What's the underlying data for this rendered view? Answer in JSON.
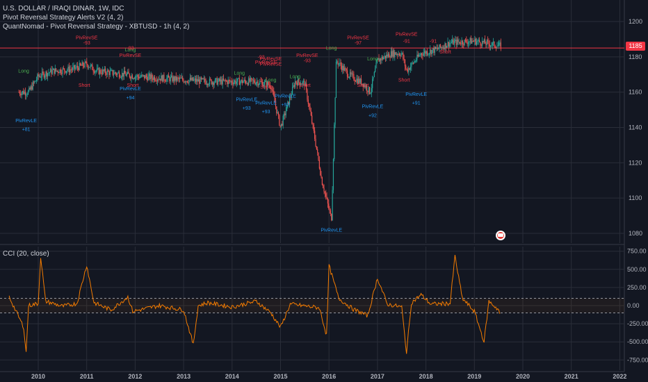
{
  "header": {
    "symbol_line": "U.S. DOLLAR / IRAQI DINAR, 1W, IDC",
    "indicator_1": "Pivot Reversal Strategy Alerts V2 (4, 2)",
    "indicator_2": "QuantNomad - Pivot Reversal Strategy - XBTUSD - 1h (4, 2)",
    "cci_label": "CCI (20, close)"
  },
  "price_badge": {
    "value": "1185",
    "color": "#f23645"
  },
  "colors": {
    "up": "#26a69a",
    "down": "#ef5350",
    "cci": "#f57c00",
    "grid": "#2a2e39",
    "bg": "#131722",
    "long": "#4caf50",
    "short": "#f23645",
    "pivot_le": "#2196f3",
    "pivot_se": "#f23645"
  },
  "chart_data": [
    {
      "type": "candlestick",
      "title": "U.S. DOLLAR / IRAQI DINAR, 1W, IDC",
      "x_tick_labels": [
        "2010",
        "2011",
        "2012",
        "2013",
        "2014",
        "2015",
        "2016",
        "2017",
        "2018",
        "2019",
        "2020",
        "2021",
        "2022"
      ],
      "y_tick_labels": [
        "1200",
        "1180",
        "1160",
        "1140",
        "1120",
        "1100",
        "1080"
      ],
      "ylim": [
        1075,
        1205
      ],
      "last_price": 1185,
      "grid": true,
      "approx_close_path": [
        {
          "x": 2009.6,
          "y": 1160
        },
        {
          "x": 2009.8,
          "y": 1160
        },
        {
          "x": 2010.0,
          "y": 1169
        },
        {
          "x": 2010.3,
          "y": 1172
        },
        {
          "x": 2010.7,
          "y": 1173
        },
        {
          "x": 2011.0,
          "y": 1176
        },
        {
          "x": 2011.2,
          "y": 1172
        },
        {
          "x": 2011.5,
          "y": 1171
        },
        {
          "x": 2011.8,
          "y": 1170
        },
        {
          "x": 2012.0,
          "y": 1169
        },
        {
          "x": 2012.5,
          "y": 1168
        },
        {
          "x": 2013.0,
          "y": 1167
        },
        {
          "x": 2013.5,
          "y": 1166
        },
        {
          "x": 2014.0,
          "y": 1166
        },
        {
          "x": 2014.5,
          "y": 1166
        },
        {
          "x": 2014.8,
          "y": 1164
        },
        {
          "x": 2015.0,
          "y": 1140
        },
        {
          "x": 2015.3,
          "y": 1166
        },
        {
          "x": 2015.5,
          "y": 1165
        },
        {
          "x": 2015.7,
          "y": 1135
        },
        {
          "x": 2015.85,
          "y": 1110
        },
        {
          "x": 2016.05,
          "y": 1088
        },
        {
          "x": 2016.15,
          "y": 1178
        },
        {
          "x": 2016.4,
          "y": 1170
        },
        {
          "x": 2016.7,
          "y": 1165
        },
        {
          "x": 2016.85,
          "y": 1160
        },
        {
          "x": 2017.0,
          "y": 1178
        },
        {
          "x": 2017.3,
          "y": 1182
        },
        {
          "x": 2017.5,
          "y": 1182
        },
        {
          "x": 2017.6,
          "y": 1172
        },
        {
          "x": 2017.9,
          "y": 1182
        },
        {
          "x": 2018.2,
          "y": 1184
        },
        {
          "x": 2018.5,
          "y": 1188
        },
        {
          "x": 2019.0,
          "y": 1189
        },
        {
          "x": 2019.55,
          "y": 1186
        }
      ],
      "annotations": {
        "long": [
          "Long",
          "Long",
          "Long",
          "Long",
          "Long",
          "Long",
          "Long"
        ],
        "short": [
          "Short",
          "Short",
          "Short",
          "Short",
          "Short",
          "Short",
          "Short"
        ],
        "pivot_le": [
          "PivRevLE",
          "+81",
          "PivRevLE",
          "+94",
          "PivRevLE",
          "+93",
          "PivRevLE",
          "+93",
          "PivRevLE",
          "+92",
          "PivRevLE",
          "PivRevLE",
          "+92",
          "PivRevLE",
          "+91"
        ],
        "pivot_se": [
          "PivRevSE",
          "-93",
          "PivRevSE",
          "-93",
          "PivRevSE",
          "-93",
          "PivRevSE",
          "PivRevSE",
          "-93",
          "PivRevSE",
          "-97",
          "PivRevSE",
          "-91",
          "PivRevSE",
          "-91"
        ]
      }
    },
    {
      "type": "line",
      "title": "CCI (20, close)",
      "x_tick_labels": [
        "2010",
        "2011",
        "2012",
        "2013",
        "2014",
        "2015",
        "2016",
        "2017",
        "2018",
        "2019",
        "2020",
        "2021",
        "2022"
      ],
      "y_tick_labels": [
        "750.00",
        "500.00",
        "250.00",
        "0.00",
        "-250.00",
        "-500.00",
        "-750.00"
      ],
      "ylim": [
        -830,
        850
      ],
      "bands": [
        100,
        -100
      ],
      "series": [
        {
          "values": [
            {
              "x": 2009.4,
              "y": 120
            },
            {
              "x": 2009.7,
              "y": -300
            },
            {
              "x": 2009.75,
              "y": -650
            },
            {
              "x": 2009.8,
              "y": 0
            },
            {
              "x": 2010.0,
              "y": 30
            },
            {
              "x": 2010.05,
              "y": 680
            },
            {
              "x": 2010.15,
              "y": 60
            },
            {
              "x": 2010.5,
              "y": -10
            },
            {
              "x": 2010.8,
              "y": 30
            },
            {
              "x": 2011.0,
              "y": 560
            },
            {
              "x": 2011.15,
              "y": 40
            },
            {
              "x": 2011.5,
              "y": -60
            },
            {
              "x": 2011.85,
              "y": 120
            },
            {
              "x": 2011.95,
              "y": -80
            },
            {
              "x": 2012.5,
              "y": 0
            },
            {
              "x": 2013.0,
              "y": -60
            },
            {
              "x": 2013.2,
              "y": -540
            },
            {
              "x": 2013.3,
              "y": 0
            },
            {
              "x": 2013.5,
              "y": 40
            },
            {
              "x": 2014.0,
              "y": -20
            },
            {
              "x": 2014.5,
              "y": 60
            },
            {
              "x": 2014.8,
              "y": -100
            },
            {
              "x": 2015.0,
              "y": -300
            },
            {
              "x": 2015.2,
              "y": 20
            },
            {
              "x": 2015.8,
              "y": -30
            },
            {
              "x": 2015.95,
              "y": -410
            },
            {
              "x": 2016.0,
              "y": 550
            },
            {
              "x": 2016.2,
              "y": 100
            },
            {
              "x": 2016.5,
              "y": -50
            },
            {
              "x": 2016.8,
              "y": -140
            },
            {
              "x": 2017.0,
              "y": 380
            },
            {
              "x": 2017.2,
              "y": 20
            },
            {
              "x": 2017.5,
              "y": -20
            },
            {
              "x": 2017.6,
              "y": -650
            },
            {
              "x": 2017.7,
              "y": 40
            },
            {
              "x": 2017.9,
              "y": 150
            },
            {
              "x": 2018.1,
              "y": 20
            },
            {
              "x": 2018.5,
              "y": 30
            },
            {
              "x": 2018.6,
              "y": 680
            },
            {
              "x": 2018.75,
              "y": 100
            },
            {
              "x": 2019.0,
              "y": -80
            },
            {
              "x": 2019.2,
              "y": -500
            },
            {
              "x": 2019.3,
              "y": 60
            },
            {
              "x": 2019.5,
              "y": -60
            },
            {
              "x": 2019.55,
              "y": -150
            }
          ]
        }
      ],
      "grid": true
    }
  ]
}
